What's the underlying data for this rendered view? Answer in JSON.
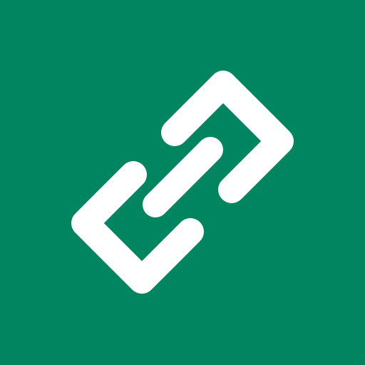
{
  "icon": {
    "name": "link-icon",
    "background_color": "#008561",
    "glyph_color": "#FFFFFF"
  }
}
